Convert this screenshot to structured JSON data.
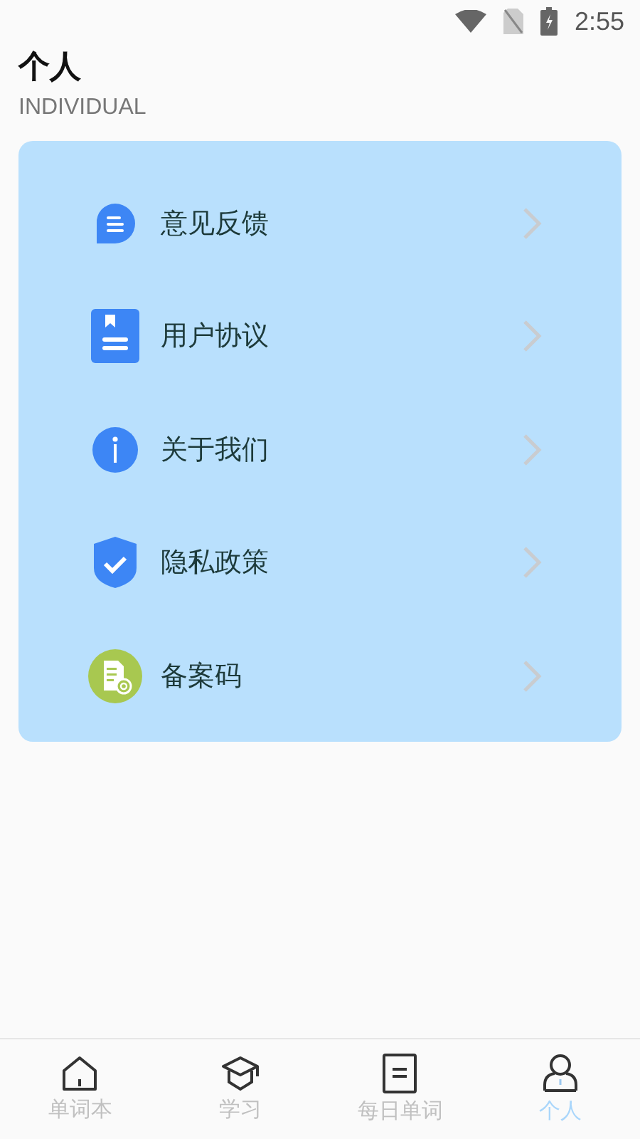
{
  "status_bar": {
    "time": "2:55"
  },
  "header": {
    "title": "个人",
    "subtitle": "INDIVIDUAL"
  },
  "menu": [
    {
      "label": "意见反馈"
    },
    {
      "label": "用户协议"
    },
    {
      "label": "关于我们"
    },
    {
      "label": "隐私政策"
    },
    {
      "label": "备案码"
    }
  ],
  "tabs": [
    {
      "label": "单词本",
      "selected": false
    },
    {
      "label": "学习",
      "selected": false
    },
    {
      "label": "每日单词",
      "selected": false
    },
    {
      "label": "个人",
      "selected": true
    }
  ]
}
